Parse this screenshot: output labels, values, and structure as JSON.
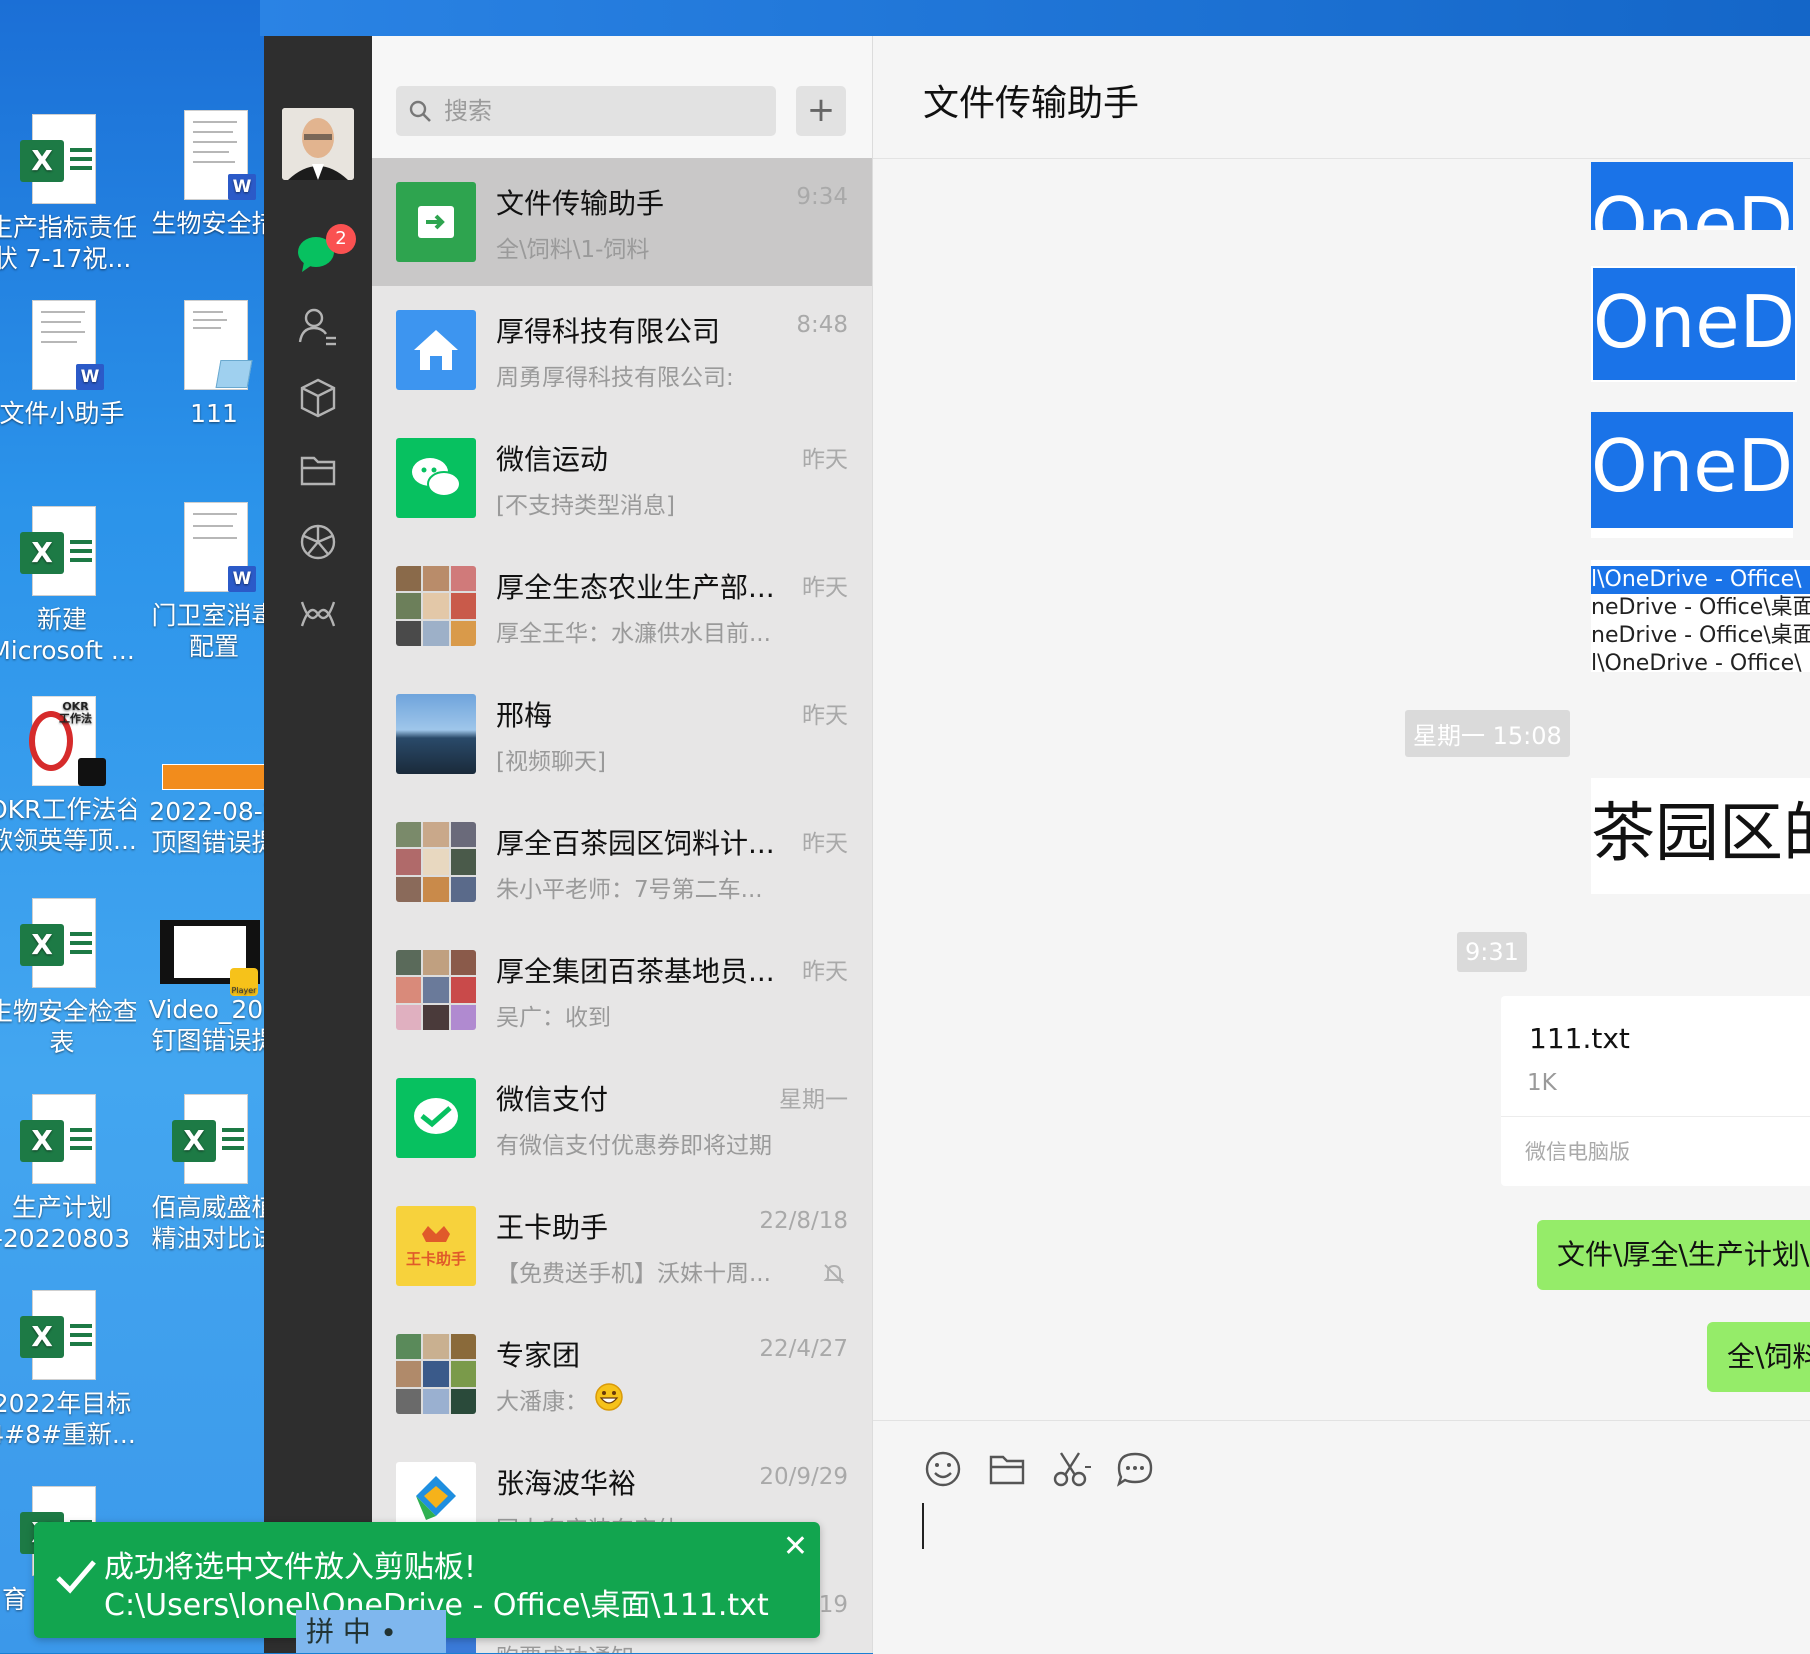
{
  "desktop": {
    "icons": [
      {
        "label1": "生产指标责任",
        "label2": "状 7-17祝..."
      },
      {
        "label1": "生物安全措",
        "label2": ""
      },
      {
        "label1": "文件小助手",
        "label2": ""
      },
      {
        "label1": "111",
        "label2": ""
      },
      {
        "label1": "新建",
        "label2": "Microsoft ..."
      },
      {
        "label1": "门卫室消毒",
        "label2": "配置"
      },
      {
        "label1": "OKR工作法谷",
        "label2": "歌领英等顶..."
      },
      {
        "label1": "2022-08-2",
        "label2": "顶图错误提"
      },
      {
        "label1": "生物安全检查",
        "label2": "表"
      },
      {
        "label1": "Video_202",
        "label2": "钉图错误提"
      },
      {
        "label1": "生产计划",
        "label2": "-20220803"
      },
      {
        "label1": "佰高威盛植",
        "label2": "精油对比试"
      },
      {
        "label1": "2022年目标",
        "label2": "4#8#重新..."
      },
      {
        "label1": "育",
        "label2": ""
      }
    ],
    "okr_text": "OKR\n工作法",
    "player_text": "Player",
    "ime": "拼 中 ∙"
  },
  "nav": {
    "badge": "2",
    "icons": [
      "chat-icon",
      "contacts-icon",
      "box-icon",
      "folder-icon",
      "moments-icon",
      "miniprogram-icon"
    ]
  },
  "search": {
    "placeholder": "搜索",
    "plus": "+"
  },
  "chats": [
    {
      "name": "文件传输助手",
      "time": "9:34",
      "preview": "全\\饲料\\1-饲料",
      "active": true
    },
    {
      "name": "厚得科技有限公司",
      "time": "8:48",
      "preview": "周勇厚得科技有限公司:"
    },
    {
      "name": "微信运动",
      "time": "昨天",
      "preview": "[不支持类型消息]"
    },
    {
      "name": "厚全生态农业生产部...",
      "time": "昨天",
      "preview": "厚全王华：水濂供水目前..."
    },
    {
      "name": "邢梅",
      "time": "昨天",
      "preview": "[视频聊天]"
    },
    {
      "name": "厚全百茶园区饲料计...",
      "time": "昨天",
      "preview": "朱小平老师：7号第二车..."
    },
    {
      "name": "厚全集团百茶基地员...",
      "time": "昨天",
      "preview": "吴广：收到"
    },
    {
      "name": "微信支付",
      "time": "星期一",
      "preview": "有微信支付优惠券即将过期"
    },
    {
      "name": "王卡助手",
      "time": "22/8/18",
      "preview": "【免费送手机】沃妹十周..."
    },
    {
      "name": "专家团",
      "time": "22/4/27",
      "preview": "大潘康："
    },
    {
      "name": "张海波华裕",
      "time": "20/9/29",
      "preview": "国大东实装东实体"
    },
    {
      "name": "",
      "time": "19",
      "preview": "购票成功通知"
    }
  ],
  "wangka_logo": "王卡助手",
  "huayu_logo": "华裕",
  "conversation": {
    "title": "文件传输助手",
    "img1_text": "OneD",
    "img2_text": "OneD",
    "img3_text": "OneD",
    "img4_lines": [
      "l\\OneDrive - Office\\",
      "neDrive - Office\\桌面\\",
      "neDrive - Office\\桌面\\",
      "l\\OneDrive - Office\\"
    ],
    "time1": "星期一 15:08",
    "img5_text": "茶园区的",
    "time2": "9:31",
    "file_name": "111.txt",
    "file_size": "1K",
    "file_source": "微信电脑版",
    "msg1": "文件\\厚全\\生产计划\\",
    "msg2": "全\\饲料"
  },
  "toast": {
    "line1": "成功将选中文件放入剪贴板!",
    "line2": "C:\\Users\\lonel\\OneDrive - Office\\桌面\\111.txt",
    "close": "✕"
  },
  "colors": {
    "wechat_green": "#07c160",
    "bubble_green": "#95ec69",
    "badge_red": "#fa5151",
    "toast_green": "#12a54f"
  }
}
